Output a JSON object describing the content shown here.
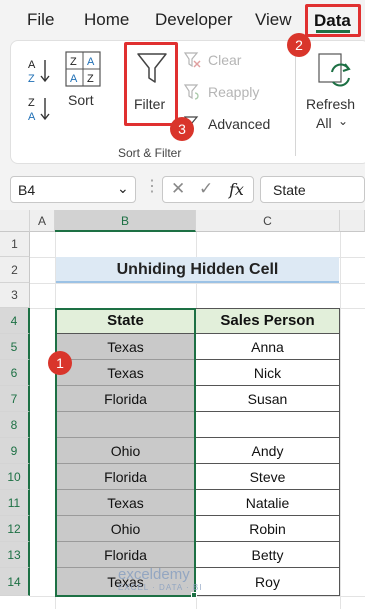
{
  "ribbon_tabs": {
    "file": "File",
    "home": "Home",
    "developer": "Developer",
    "view": "View",
    "data": "Data"
  },
  "ribbon": {
    "sort_label": "Sort",
    "filter_label": "Filter",
    "clear_label": "Clear",
    "reapply_label": "Reapply",
    "advanced_label": "Advanced",
    "refresh_label": "Refresh",
    "refresh_all_label": "All",
    "group_label": "Sort & Filter",
    "sort_az": "A↓Z",
    "sort_za": "Z↓A"
  },
  "badges": {
    "b1": "1",
    "b2": "2",
    "b3": "3"
  },
  "formula_bar": {
    "name_box": "B4",
    "fx": "fx",
    "value": "State"
  },
  "grid": {
    "col_a": "A",
    "col_b": "B",
    "col_c": "C",
    "rows": [
      "1",
      "2",
      "3",
      "4",
      "5",
      "6",
      "7",
      "8",
      "9",
      "10",
      "11",
      "12",
      "13",
      "14"
    ]
  },
  "sheet": {
    "title": "Unhiding Hidden Cell",
    "headers": {
      "state": "State",
      "sales": "Sales Person"
    },
    "records": [
      {
        "state": "Texas",
        "person": "Anna"
      },
      {
        "state": "Texas",
        "person": "Nick"
      },
      {
        "state": "Florida",
        "person": "Susan"
      },
      {
        "state": "",
        "person": ""
      },
      {
        "state": "Ohio",
        "person": "Andy"
      },
      {
        "state": "Florida",
        "person": "Steve"
      },
      {
        "state": "Texas",
        "person": "Natalie"
      },
      {
        "state": "Ohio",
        "person": "Robin"
      },
      {
        "state": "Florida",
        "person": "Betty"
      },
      {
        "state": "Texas",
        "person": "Roy"
      }
    ]
  },
  "watermark": {
    "name": "exceldemy",
    "tagline": "EXCEL · DATA · BI"
  },
  "colors": {
    "accent_green": "#1d7044",
    "highlight_red": "#e03030",
    "header_green": "#e2efda",
    "title_blue": "#dde9f4"
  }
}
